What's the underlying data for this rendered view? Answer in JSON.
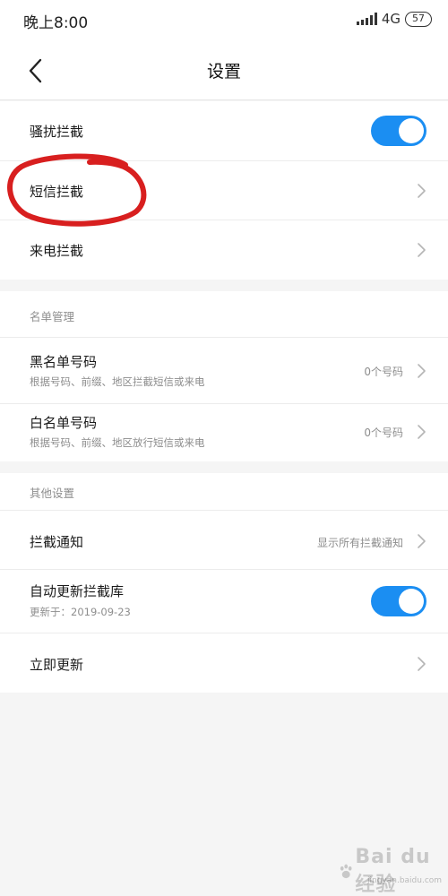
{
  "status_bar": {
    "time": "晚上8:00",
    "network": "4G",
    "battery": "57"
  },
  "header": {
    "title": "设置"
  },
  "interception": {
    "harassment": {
      "label": "骚扰拦截",
      "enabled": true
    },
    "sms": {
      "label": "短信拦截"
    },
    "call": {
      "label": "来电拦截"
    }
  },
  "list_management": {
    "header": "名单管理",
    "blacklist": {
      "label": "黑名单号码",
      "subtitle": "根据号码、前缀、地区拦截短信或来电",
      "value": "0个号码"
    },
    "whitelist": {
      "label": "白名单号码",
      "subtitle": "根据号码、前缀、地区放行短信或来电",
      "value": "0个号码"
    }
  },
  "other_settings": {
    "header": "其他设置",
    "notification": {
      "label": "拦截通知",
      "value": "显示所有拦截通知"
    },
    "auto_update": {
      "label": "自动更新拦截库",
      "subtitle": "更新于：2019-09-23",
      "enabled": true
    },
    "update_now": {
      "label": "立即更新"
    }
  },
  "watermark": {
    "text": "Bai du 经验",
    "url": "jingyan.baidu.com"
  },
  "colors": {
    "accent": "#1b8ef2",
    "annotation": "#d81f1f"
  }
}
